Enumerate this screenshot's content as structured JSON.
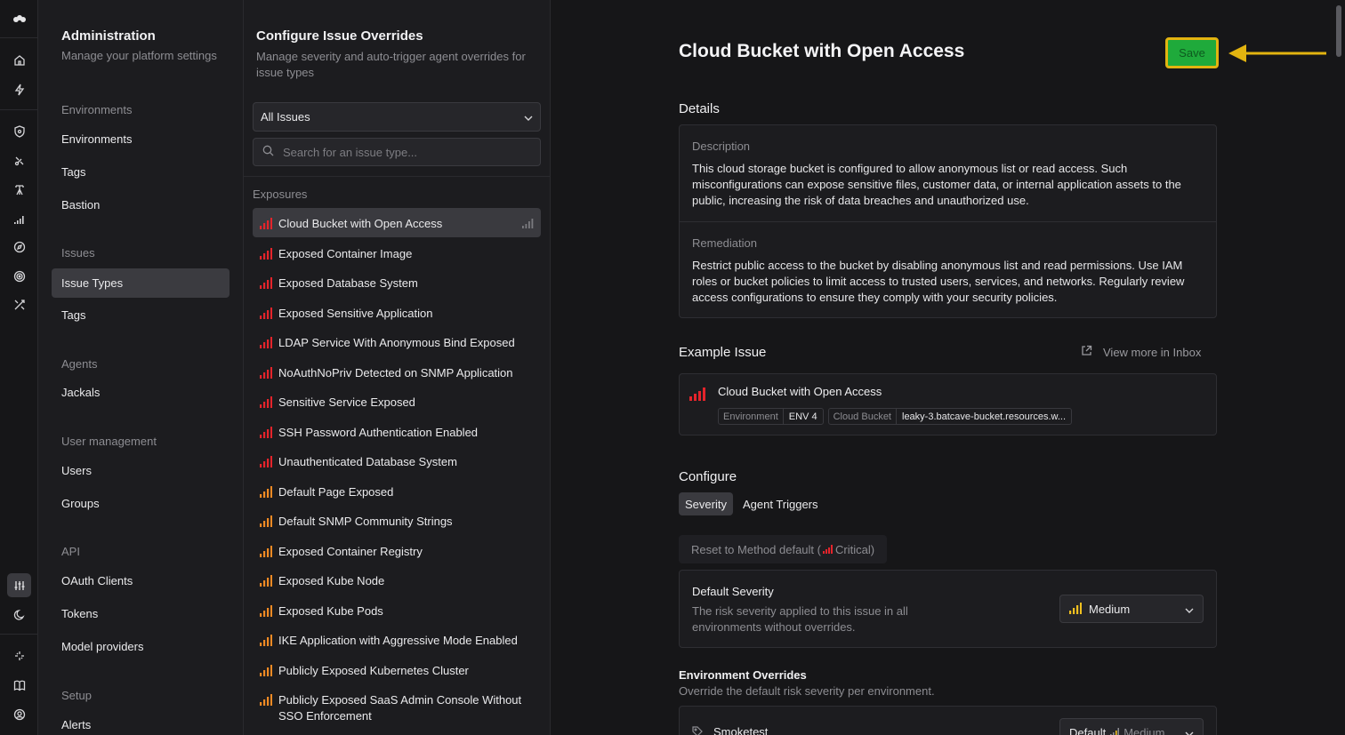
{
  "rail": {
    "icons": [
      "logo-icon",
      "home-icon",
      "bolt-icon",
      "shield-icon",
      "satellite-icon",
      "tower-icon",
      "signal-icon",
      "compass-icon",
      "target-icon",
      "tools-icon",
      "sliders-icon",
      "moon-icon",
      "sparkle-icon",
      "book-icon",
      "user-circle-icon"
    ]
  },
  "admin": {
    "title": "Administration",
    "subtitle": "Manage your platform settings",
    "sections": [
      {
        "label": "Environments",
        "items": [
          "Environments",
          "Tags",
          "Bastion"
        ]
      },
      {
        "label": "Issues",
        "items": [
          "Issue Types",
          "Tags"
        ]
      },
      {
        "label": "Agents",
        "items": [
          "Jackals"
        ]
      },
      {
        "label": "User management",
        "items": [
          "Users",
          "Groups"
        ]
      },
      {
        "label": "API",
        "items": [
          "OAuth Clients",
          "Tokens",
          "Model providers"
        ]
      },
      {
        "label": "Setup",
        "items": [
          "Alerts"
        ]
      }
    ]
  },
  "overrides": {
    "title": "Configure Issue Overrides",
    "subtitle": "Manage severity and auto-trigger agent overrides for issue types",
    "filter_value": "All Issues",
    "search_placeholder": "Search for an issue type...",
    "group": "Exposures",
    "issues": [
      {
        "label": "Cloud Bucket with Open Access",
        "severity": "critical"
      },
      {
        "label": "Exposed Container Image",
        "severity": "critical"
      },
      {
        "label": "Exposed Database System",
        "severity": "critical"
      },
      {
        "label": "Exposed Sensitive Application",
        "severity": "critical"
      },
      {
        "label": "LDAP Service With Anonymous Bind Exposed",
        "severity": "critical"
      },
      {
        "label": "NoAuthNoPriv Detected on SNMP Application",
        "severity": "critical"
      },
      {
        "label": "Sensitive Service Exposed",
        "severity": "critical"
      },
      {
        "label": "SSH Password Authentication Enabled",
        "severity": "critical"
      },
      {
        "label": "Unauthenticated Database System",
        "severity": "critical"
      },
      {
        "label": "Default Page Exposed",
        "severity": "high"
      },
      {
        "label": "Default SNMP Community Strings",
        "severity": "high"
      },
      {
        "label": "Exposed Container Registry",
        "severity": "high"
      },
      {
        "label": "Exposed Kube Node",
        "severity": "high"
      },
      {
        "label": "Exposed Kube Pods",
        "severity": "high"
      },
      {
        "label": "IKE Application with Aggressive Mode Enabled",
        "severity": "high"
      },
      {
        "label": "Publicly Exposed Kubernetes Cluster",
        "severity": "high"
      },
      {
        "label": "Publicly Exposed SaaS Admin Console Without SSO Enforcement",
        "severity": "high"
      }
    ]
  },
  "detail": {
    "title": "Cloud Bucket with Open Access",
    "save_label": "Save",
    "details_heading": "Details",
    "description_label": "Description",
    "description": "This cloud storage bucket is configured to allow anonymous list or read access. Such misconfigurations can expose sensitive files, customer data, or internal application assets to the public, increasing the risk of data breaches and unauthorized use.",
    "remediation_label": "Remediation",
    "remediation": "Restrict public access to the bucket by disabling anonymous list and read permissions. Use IAM roles or bucket policies to limit access to trusted users, services, and networks. Regularly review access configurations to ensure they comply with your security policies.",
    "example_heading": "Example Issue",
    "view_more": "View more in Inbox",
    "example_title": "Cloud Bucket with Open Access",
    "example_tags": [
      {
        "key": "Environment",
        "value": "ENV 4"
      },
      {
        "key": "Cloud Bucket",
        "value": "leaky-3.batcave-bucket.resources.w..."
      }
    ],
    "configure_heading": "Configure",
    "tabs": [
      "Severity",
      "Agent Triggers"
    ],
    "reset_prefix": "Reset to Method default (",
    "reset_value": "Critical)",
    "default_severity_label": "Default Severity",
    "default_severity_desc": "The risk severity applied to this issue in all environments without overrides.",
    "default_severity_value": "Medium",
    "env_overrides_heading": "Environment Overrides",
    "env_overrides_desc": "Override the default risk severity per environment.",
    "env_row_name": "Smoketest",
    "env_row_value": "Default",
    "env_row_value2": "Medium"
  },
  "colors": {
    "critical": "#e5242b",
    "high": "#f08a24",
    "medium": "#f0c020",
    "save_bg": "#1faa3b",
    "highlight": "#e2b410"
  }
}
